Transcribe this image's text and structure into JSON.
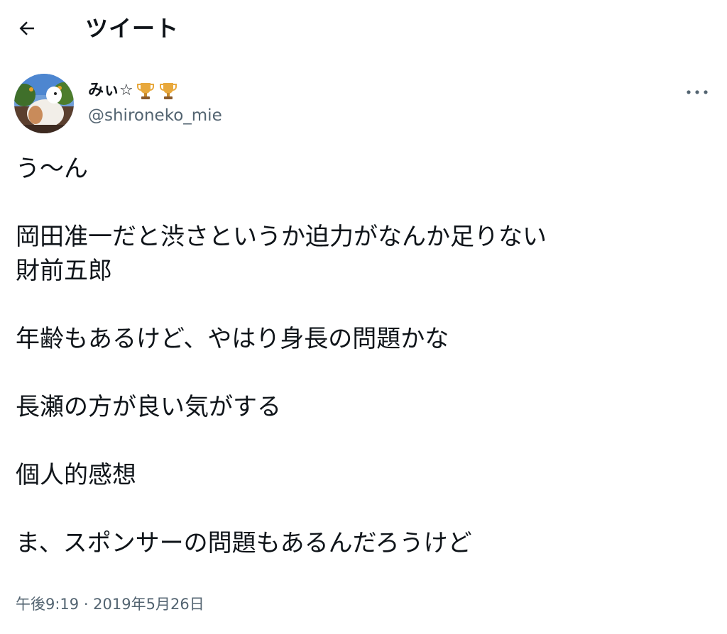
{
  "header": {
    "back_icon": "arrow-left-icon",
    "title": "ツイート"
  },
  "author": {
    "display_name": "みぃ☆",
    "badges": [
      "trophy-icon",
      "trophy-icon"
    ],
    "handle": "@shironeko_mie",
    "avatar": "avatar-photo",
    "more_icon": "more-horizontal-icon"
  },
  "tweet": {
    "lines": [
      "う〜ん",
      "",
      "岡田准一だと渋さというか迫力がなんか足りない",
      "財前五郎",
      "",
      "年齢もあるけど、やはり身長の問題かな",
      "",
      "長瀬の方が良い気がする",
      "",
      "個人的感想",
      "",
      "ま、スポンサーの問題もあるんだろうけど"
    ],
    "timestamp": "午後9:19 · 2019年5月26日"
  },
  "colors": {
    "text_primary": "#0f1419",
    "text_secondary": "#536471",
    "trophy": "#e8a83c"
  }
}
